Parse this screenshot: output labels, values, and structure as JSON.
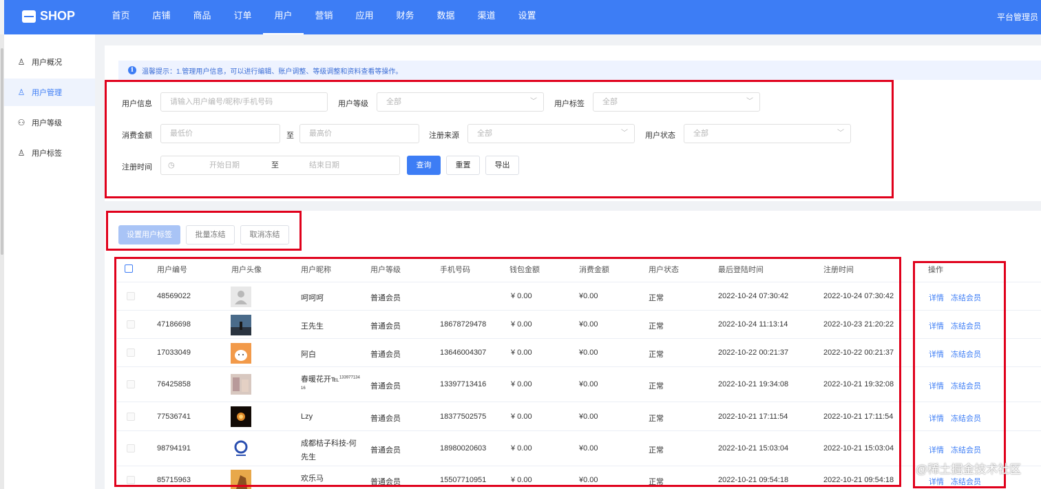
{
  "app": {
    "logo": "SHOP",
    "admin": "平台管理员"
  },
  "nav": [
    {
      "label": "首页"
    },
    {
      "label": "店铺"
    },
    {
      "label": "商品"
    },
    {
      "label": "订单"
    },
    {
      "label": "用户"
    },
    {
      "label": "营销"
    },
    {
      "label": "应用"
    },
    {
      "label": "财务"
    },
    {
      "label": "数据"
    },
    {
      "label": "渠道"
    },
    {
      "label": "设置"
    }
  ],
  "sidebar": {
    "items": [
      {
        "label": "用户概况",
        "icon": "user-icon"
      },
      {
        "label": "用户管理",
        "icon": "user-manage-icon"
      },
      {
        "label": "用户等级",
        "icon": "user-group-icon"
      },
      {
        "label": "用户标签",
        "icon": "user-tag-icon"
      }
    ]
  },
  "tip": "温馨提示：1.管理用户信息，可以进行编辑、账户调整、等级调整和资料查看等操作。",
  "filters": {
    "user_info_label": "用户信息",
    "user_info_placeholder": "请输入用户编号/昵称/手机号码",
    "level_label": "用户等级",
    "level_value": "全部",
    "tag_label": "用户标签",
    "tag_value": "全部",
    "amount_label": "消费金额",
    "min_placeholder": "最低价",
    "to": "至",
    "max_placeholder": "最高价",
    "source_label": "注册来源",
    "source_value": "全部",
    "status_label": "用户状态",
    "status_value": "全部",
    "reg_time_label": "注册时间",
    "start_date": "开始日期",
    "end_date": "结束日期",
    "query_btn": "查询",
    "reset_btn": "重置",
    "export_btn": "导出"
  },
  "batch": {
    "set_tag": "设置用户标签",
    "batch_freeze": "批量冻结",
    "unfreeze": "取消冻结"
  },
  "table": {
    "headers": [
      "用户编号",
      "用户头像",
      "用户昵称",
      "用户等级",
      "手机号码",
      "钱包金额",
      "消费金额",
      "用户状态",
      "最后登陆时间",
      "注册时间",
      "操作"
    ],
    "detail_link": "详情",
    "freeze_link": "冻结会员",
    "rows": [
      {
        "id": "48569022",
        "nickname": "呵呵呵",
        "level": "普通会员",
        "phone": "",
        "wallet": "¥ 0.00",
        "spend": "¥0.00",
        "status": "正常",
        "last_login": "2022-10-24 07:30:42",
        "reg_time": "2022-10-24 07:30:42"
      },
      {
        "id": "47186698",
        "nickname": "王先生",
        "level": "普通会员",
        "phone": "18678729478",
        "wallet": "¥ 0.00",
        "spend": "¥0.00",
        "status": "正常",
        "last_login": "2022-10-24 11:13:14",
        "reg_time": "2022-10-23 21:20:22"
      },
      {
        "id": "17033049",
        "nickname": "阿白",
        "level": "普通会员",
        "phone": "13646004307",
        "wallet": "¥ 0.00",
        "spend": "¥0.00",
        "status": "正常",
        "last_login": "2022-10-22 00:21:37",
        "reg_time": "2022-10-22 00:21:37"
      },
      {
        "id": "76425858",
        "nickname": "春暖花开℡",
        "nickname_sup": "133977134",
        "nickname_line2": "16",
        "level": "普通会员",
        "phone": "13397713416",
        "wallet": "¥ 0.00",
        "spend": "¥0.00",
        "status": "正常",
        "last_login": "2022-10-21 19:34:08",
        "reg_time": "2022-10-21 19:32:08"
      },
      {
        "id": "77536741",
        "nickname": "Lzy",
        "level": "普通会员",
        "phone": "18377502575",
        "wallet": "¥ 0.00",
        "spend": "¥0.00",
        "status": "正常",
        "last_login": "2022-10-21 17:11:54",
        "reg_time": "2022-10-21 17:11:54"
      },
      {
        "id": "98794191",
        "nickname": "成都桔子科技-何",
        "nickname_line2": "先生",
        "level": "普通会员",
        "phone": "18980020603",
        "wallet": "¥ 0.00",
        "spend": "¥0.00",
        "status": "正常",
        "last_login": "2022-10-21 15:03:04",
        "reg_time": "2022-10-21 15:03:04"
      },
      {
        "id": "85715963",
        "nickname": "欢乐马",
        "level": "普通会员",
        "phone": "15507710951",
        "wallet": "¥ 0.00",
        "spend": "¥0.00",
        "status": "正常",
        "last_login": "2022-10-21 09:54:18",
        "reg_time": "2022-10-21 09:54:18"
      }
    ]
  },
  "watermark": "@稀土掘金技术社区",
  "colors": {
    "primary": "#3d7df5",
    "highlight": "#e0001b"
  }
}
